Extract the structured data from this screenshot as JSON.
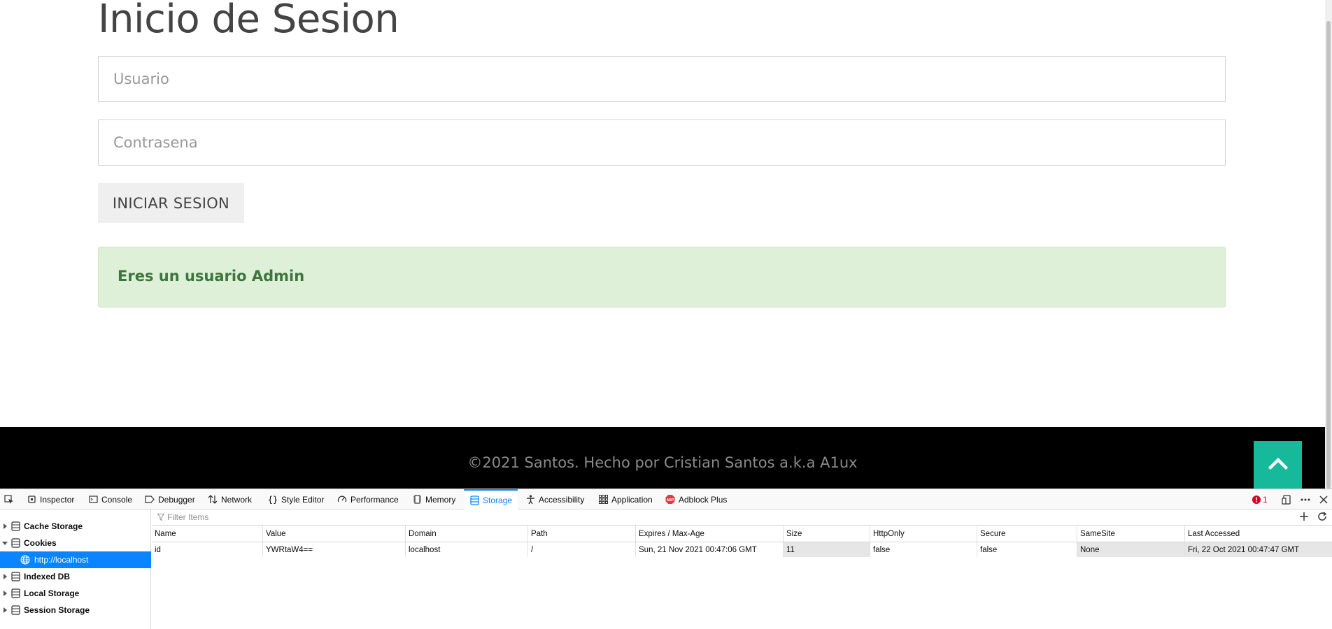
{
  "page": {
    "title": "Inicio de Sesion",
    "username_placeholder": "Usuario",
    "password_placeholder": "Contrasena",
    "login_button": "INICIAR SESION",
    "alert_message": "Eres un usuario Admin",
    "footer_text": "©2021 Santos. Hecho por Cristian Santos a.k.a A1ux",
    "accent_color": "#16b99a"
  },
  "devtools": {
    "tabs": [
      {
        "label": "Inspector",
        "icon": "inspector-icon"
      },
      {
        "label": "Console",
        "icon": "console-icon"
      },
      {
        "label": "Debugger",
        "icon": "debugger-icon"
      },
      {
        "label": "Network",
        "icon": "network-icon"
      },
      {
        "label": "Style Editor",
        "icon": "style-editor-icon"
      },
      {
        "label": "Performance",
        "icon": "performance-icon"
      },
      {
        "label": "Memory",
        "icon": "memory-icon"
      },
      {
        "label": "Storage",
        "icon": "storage-icon",
        "active": true
      },
      {
        "label": "Accessibility",
        "icon": "accessibility-icon"
      },
      {
        "label": "Application",
        "icon": "application-icon"
      },
      {
        "label": "Adblock Plus",
        "icon": "adblock-plus-icon"
      }
    ],
    "error_count": "1",
    "tree": {
      "cache_storage": "Cache Storage",
      "cookies": "Cookies",
      "cookie_host": "http://localhost",
      "indexed_db": "Indexed DB",
      "local_storage": "Local Storage",
      "session_storage": "Session Storage"
    },
    "filter_placeholder": "Filter Items",
    "columns": [
      "Name",
      "Value",
      "Domain",
      "Path",
      "Expires / Max-Age",
      "Size",
      "HttpOnly",
      "Secure",
      "SameSite",
      "Last Accessed"
    ],
    "rows": [
      [
        "id",
        "YWRtaW4==",
        "localhost",
        "/",
        "Sun, 21 Nov 2021 00:47:06 GMT",
        "11",
        "false",
        "false",
        "None",
        "Fri, 22 Oct 2021 00:47:47 GMT"
      ]
    ]
  }
}
